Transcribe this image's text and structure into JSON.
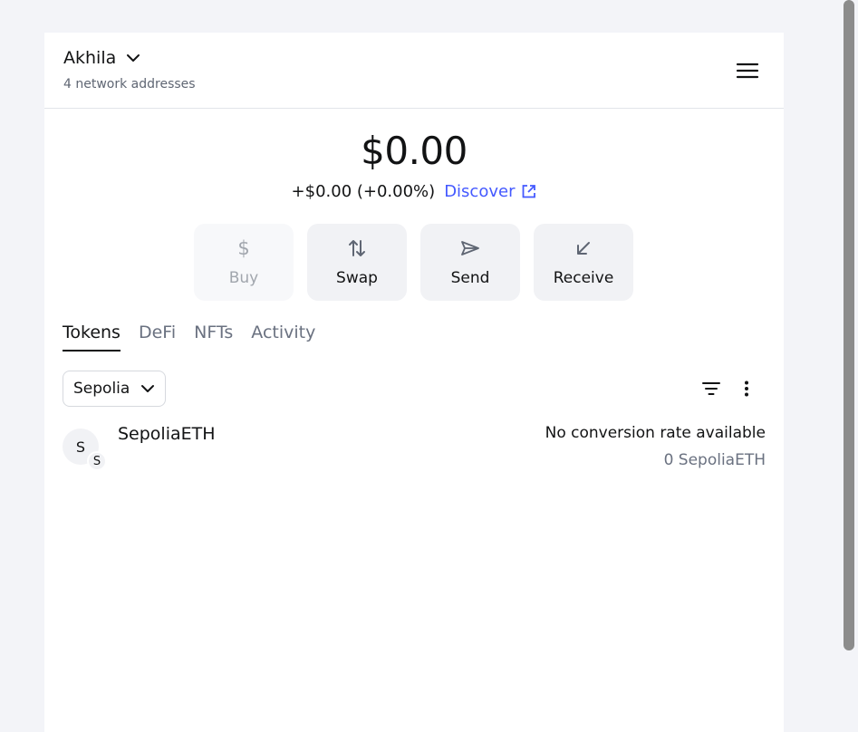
{
  "header": {
    "account_name": "Akhila",
    "network_addresses": "4 network addresses"
  },
  "balance": {
    "total": "$0.00",
    "change": "+$0.00 (+0.00%)",
    "discover_label": "Discover"
  },
  "actions": [
    {
      "label": "Buy",
      "icon": "dollar-icon",
      "disabled": true
    },
    {
      "label": "Swap",
      "icon": "swap-arrows-icon",
      "disabled": false
    },
    {
      "label": "Send",
      "icon": "send-arrow-icon",
      "disabled": false
    },
    {
      "label": "Receive",
      "icon": "receive-arrow-icon",
      "disabled": false
    }
  ],
  "tabs": [
    {
      "label": "Tokens",
      "active": true
    },
    {
      "label": "DeFi",
      "active": false
    },
    {
      "label": "NFTs",
      "active": false
    },
    {
      "label": "Activity",
      "active": false
    }
  ],
  "network_filter": {
    "selected": "Sepolia"
  },
  "tokens": [
    {
      "avatar_letter": "S",
      "badge_letter": "S",
      "name": "SepoliaETH",
      "rate": "No conversion rate available",
      "amount": "0 SepoliaETH"
    }
  ],
  "colors": {
    "accent": "#4459ff",
    "page_bg": "#f3f4f8",
    "panel_bg": "#ffffff",
    "button_bg": "#f1f2f5",
    "muted_text": "#6a7180"
  }
}
